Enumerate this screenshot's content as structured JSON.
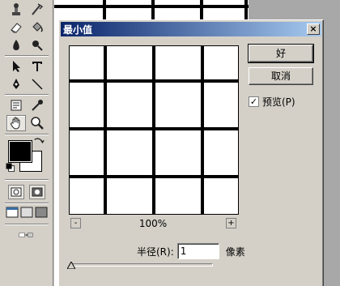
{
  "dialog": {
    "title": "最小值",
    "close_label": "×",
    "ok_label": "好",
    "cancel_label": "取消",
    "preview_label": "预览(P)",
    "preview_checked": true,
    "preview_check_mark": "✓",
    "zoom_minus": "-",
    "zoom_plus": "+",
    "zoom_level": "100%",
    "radius_label": "半径(R):",
    "radius_value": "1",
    "radius_unit": "像素"
  },
  "toolbox": {
    "tools": [
      "stamp-icon",
      "history-brush-icon",
      "eraser-icon",
      "paint-bucket-icon",
      "blur-icon",
      "burn-icon",
      "path-select-icon",
      "type-icon",
      "pen-icon",
      "line-icon",
      "notes-icon",
      "eyedropper-icon",
      "hand-icon",
      "zoom-icon"
    ],
    "foreground_color": "#000000",
    "background_color": "#ffffff"
  }
}
